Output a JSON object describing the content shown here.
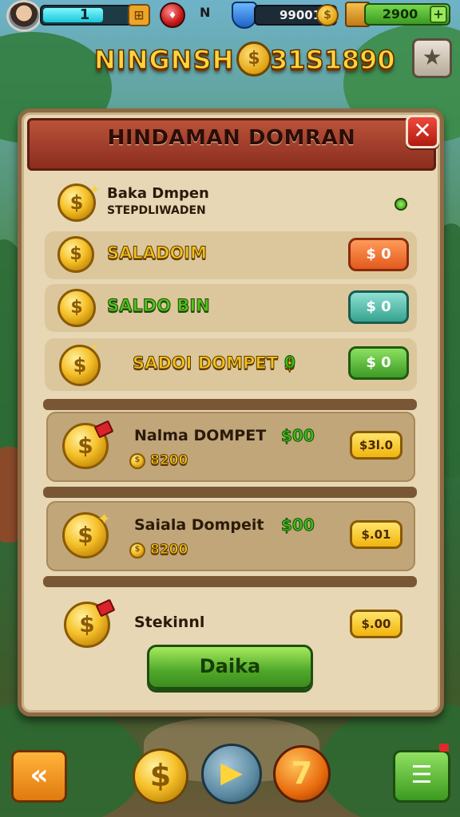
{
  "hud": {
    "level": "1",
    "xp_fill": 0.72,
    "icon_n": "N",
    "coins": "99001",
    "cash": "2900",
    "plus": "+"
  },
  "banner": {
    "title": "NINGNSH",
    "value": "31S1890"
  },
  "panel": {
    "title": "HINDAMAN DOMRAN",
    "close": "✕",
    "header_row": {
      "title": "Baka Dmpen",
      "subtitle": "STEPDLIWADEN"
    },
    "rows": [
      {
        "label": "SALADOIM",
        "value": "$ 0",
        "style": "orange"
      },
      {
        "label": "SALDO BIN",
        "value": "$ 0",
        "style": "teal"
      },
      {
        "label": "SADOI DOMPET $",
        "badge": "0",
        "value": "$ 0",
        "style": "green"
      }
    ],
    "cards": [
      {
        "name": "Nalma DOMPET",
        "amount": "$00",
        "sub": "8200",
        "button": "$3l.0"
      },
      {
        "name": "Saiala Dompeit",
        "amount": "$00",
        "sub": "8200",
        "button": "$.01"
      },
      {
        "name": "Stekinnl",
        "button": "$.00"
      }
    ],
    "main_button": "Daika"
  },
  "bottom": {
    "back": "«",
    "dollar": "$",
    "play": "▶",
    "seven": "7",
    "menu": "☰"
  },
  "colors": {
    "panel_bg": "#e7d7b4",
    "header_red": "#b9523a",
    "gold": "#f2c01e",
    "green": "#4fa82a"
  }
}
